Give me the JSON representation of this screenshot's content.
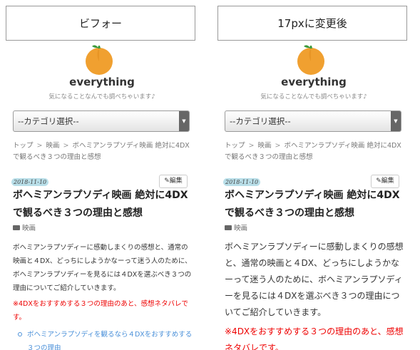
{
  "labels": {
    "before": "ビフォー",
    "after": "17pxに変更後"
  },
  "site": {
    "title": "everything",
    "tagline": "気になることなんでも調べちゃいます♪"
  },
  "category_select": {
    "selected": "--カテゴリ選択--"
  },
  "breadcrumb": {
    "items": [
      "トップ",
      "映画",
      "ボヘミアンラプソディ映画 絶対に4DXで観るべき３つの理由と感想"
    ],
    "separator": ">"
  },
  "post": {
    "date": "2018-11-10",
    "edit_label": "編集",
    "title": "ボヘミアンラプソディ映画 絶対に4DXで観るべき３つの理由と感想",
    "category": "映画",
    "body": "ボヘミアンラプソディーに感動しまくりの感想と、通常の映画と４DX、どっちにしようかなーって迷う人のために、ボヘミアンラプソディーを見るには４DXを選ぶべき３つの理由についてご紹介していきます。",
    "note": "※4DXをおすすめする３つの理由のあと、感想ネタバレです。",
    "toc": [
      "ボヘミアンラプソディを観るなら４DXをおすすめする３つの理由"
    ]
  },
  "colors": {
    "accent_link": "#4a90d9",
    "note_red": "#ee0000",
    "date_badge": "#b9dfe9",
    "logo_orange": "#f0a030",
    "logo_leaf": "#3c9a3c"
  }
}
